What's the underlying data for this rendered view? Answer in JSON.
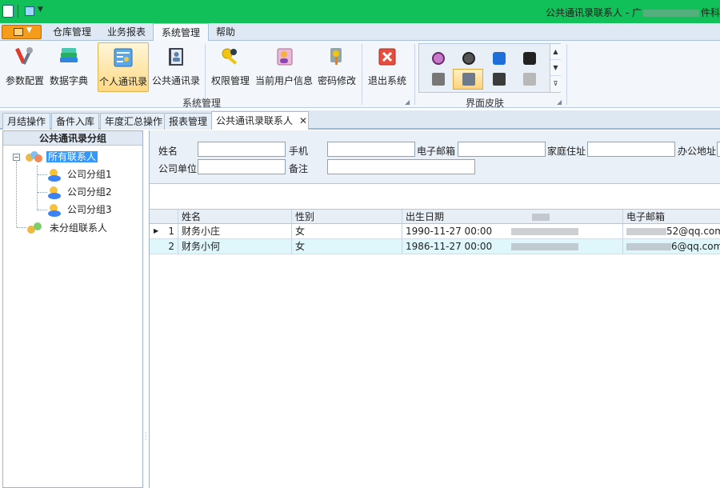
{
  "window": {
    "title": "公共通讯录联系人 - 广",
    "title_suffix": "件科"
  },
  "menu": {
    "tabs": [
      "仓库管理",
      "业务报表",
      "系统管理",
      "帮助"
    ],
    "active": "系统管理"
  },
  "ribbon": {
    "buttons": [
      {
        "label": "参数配置",
        "icon": "tools-icon"
      },
      {
        "label": "数据字典",
        "icon": "books-icon"
      },
      {
        "label": "个人通讯录",
        "icon": "address-card-icon",
        "selected": true
      },
      {
        "label": "公共通讯录",
        "icon": "contact-book-icon"
      },
      {
        "label": "权限管理",
        "icon": "keys-icon"
      },
      {
        "label": "当前用户信息",
        "icon": "user-info-icon"
      },
      {
        "label": "密码修改",
        "icon": "password-key-icon"
      },
      {
        "label": "退出系统",
        "icon": "exit-icon"
      }
    ],
    "group_system": "系统管理",
    "group_skin": "界面皮肤"
  },
  "doc_tabs": [
    "月结操作",
    "备件入库",
    "年度汇总操作",
    "报表管理",
    "公共通讯录联系人"
  ],
  "tree": {
    "header": "公共通讯录分组",
    "root": "所有联系人",
    "children": [
      "公司分组1",
      "公司分组2",
      "公司分组3"
    ],
    "ungrouped": "未分组联系人"
  },
  "form": {
    "name_label": "姓名",
    "mobile_label": "手机",
    "email_label": "电子邮箱",
    "home_label": "家庭住址",
    "office_label": "办公地址",
    "company_label": "公司单位",
    "note_label": "备注"
  },
  "grid": {
    "columns": [
      "姓名",
      "性别",
      "出生日期",
      "电子邮箱"
    ],
    "rows": [
      {
        "num": "1",
        "name": "财务小庄",
        "gender": "女",
        "birth": "1990-11-27 00:00",
        "email": "52@qq.com"
      },
      {
        "num": "2",
        "name": "财务小何",
        "gender": "女",
        "birth": "1986-11-27 00:00",
        "email": "6@qq.com"
      }
    ]
  },
  "colors": {
    "titlebar": "#12c05a",
    "ribbon_bg": "#f3f7fb",
    "selected_row": "#dff6fb",
    "selection": "#3399ff"
  }
}
